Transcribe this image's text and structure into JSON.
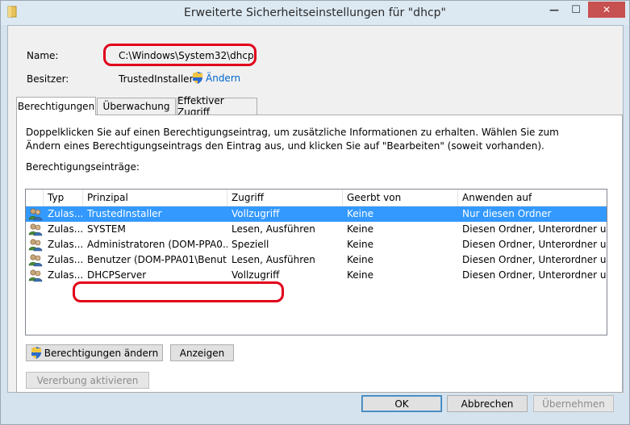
{
  "window": {
    "title": "Erweiterte Sicherheitseinstellungen für \"dhcp\"",
    "minimize_glyph": "—",
    "maximize_glyph": "☐",
    "close_glyph": "✕"
  },
  "header": {
    "name_label": "Name:",
    "name_value": "C:\\Windows\\System32\\dhcp",
    "owner_label": "Besitzer:",
    "owner_value": "TrustedInstaller",
    "owner_change_link": "Ändern"
  },
  "tabs": [
    {
      "label": "Berechtigungen",
      "active": true
    },
    {
      "label": "Überwachung",
      "active": false
    },
    {
      "label": "Effektiver Zugriff",
      "active": false
    }
  ],
  "permissions": {
    "instructions": "Doppelklicken Sie auf einen Berechtigungseintrag, um zusätzliche Informationen zu erhalten. Wählen Sie zum Ändern eines Berechtigungseintrags den Eintrag aus, und klicken Sie auf \"Bearbeiten\" (soweit vorhanden).",
    "list_label": "Berechtigungseinträge:",
    "columns": [
      "Typ",
      "Prinzipal",
      "Zugriff",
      "Geerbt von",
      "Anwenden auf"
    ],
    "rows": [
      {
        "type": "Zulas...",
        "principal": "TrustedInstaller",
        "access": "Vollzugriff",
        "inherited": "Keine",
        "applies": "Nur diesen Ordner",
        "selected": true
      },
      {
        "type": "Zulas...",
        "principal": "SYSTEM",
        "access": "Lesen, Ausführen",
        "inherited": "Keine",
        "applies": "Diesen Ordner, Unterordner un...",
        "selected": false
      },
      {
        "type": "Zulas...",
        "principal": "Administratoren (DOM-PPA0...",
        "access": "Speziell",
        "inherited": "Keine",
        "applies": "Diesen Ordner, Unterordner un...",
        "selected": false
      },
      {
        "type": "Zulas...",
        "principal": "Benutzer (DOM-PPA01\\Benut...",
        "access": "Lesen, Ausführen",
        "inherited": "Keine",
        "applies": "Diesen Ordner, Unterordner un...",
        "selected": false
      },
      {
        "type": "Zulas...",
        "principal": "DHCPServer",
        "access": "Vollzugriff",
        "inherited": "Keine",
        "applies": "Diesen Ordner, Unterordner un...",
        "selected": false
      }
    ],
    "change_permissions_button": "Berechtigungen ändern",
    "view_button": "Anzeigen",
    "enable_inheritance_button": "Vererbung aktivieren"
  },
  "footer": {
    "ok_button": "OK",
    "cancel_button": "Abbrechen",
    "apply_button": "Übernehmen"
  },
  "colors": {
    "selection": "#3399ff",
    "highlight_ring": "#e0001a",
    "link": "#0066cc"
  }
}
